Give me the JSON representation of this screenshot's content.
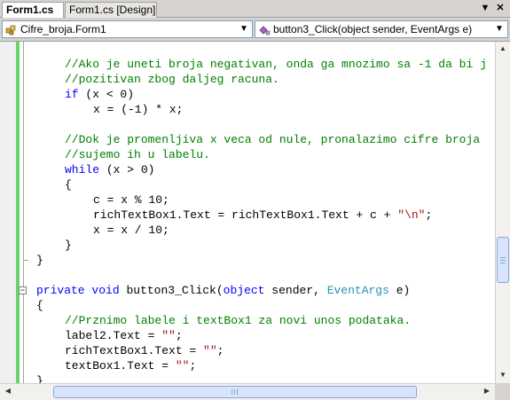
{
  "tabs": [
    {
      "label": "Form1.cs",
      "active": true
    },
    {
      "label": "Form1.cs [Design]",
      "active": false
    }
  ],
  "tab_controls": {
    "dropdown_icon": "chevron-down-icon",
    "close_icon": "close-icon"
  },
  "navbar": {
    "type_combo": "Cifre_broja.Form1",
    "member_combo": "button3_Click(object sender, EventArgs e)"
  },
  "code": {
    "line1": "//Ako je uneti broja negativan, onda ga mnozimo sa -1 da bi j",
    "line2": "//pozitivan zbog daljeg racuna.",
    "line3_kw": "if",
    "line3_rest": " (x < 0)",
    "line4": "x = (-1) * x;",
    "line6": "//Dok je promenljiva x veca od nule, pronalazimo cifre broja",
    "line7": "//sujemo ih u labelu.",
    "line8_kw": "while",
    "line8_rest": " (x > 0)",
    "line9": "{",
    "line10": "c = x % 10;",
    "line11_a": "richTextBox1.Text = richTextBox1.Text + c + ",
    "line11_str": "\"\\n\"",
    "line11_b": ";",
    "line12": "x = x / 10;",
    "line13": "}",
    "line14": "}",
    "line16_kw1": "private",
    "line16_kw2": "void",
    "line16_a": " button3_Click(",
    "line16_kw3": "object",
    "line16_b": " sender, ",
    "line16_type": "EventArgs",
    "line16_c": " e)",
    "line17": "{",
    "line18": "//Prznimo labele i textBox1 za novi unos podataka.",
    "line19_a": "label2.Text = ",
    "line19_str": "\"\"",
    "line19_b": ";",
    "line20_a": "richTextBox1.Text = ",
    "line20_str": "\"\"",
    "line20_b": ";",
    "line21_a": "textBox1.Text = ",
    "line21_str": "\"\"",
    "line21_b": ";",
    "line22": "}"
  },
  "colors": {
    "keyword": "#0000ff",
    "comment": "#008000",
    "type": "#2b91af",
    "string": "#a31515",
    "change_bar": "#6bd36b"
  }
}
